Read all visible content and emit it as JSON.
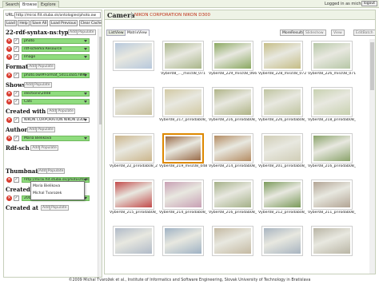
{
  "top_tabs": [
    "Search",
    "Browse",
    "Explore"
  ],
  "logged_in": "Logged in as michal",
  "logout_label": "logout",
  "url_label": "URL:",
  "url_value": "http://mirai.fiit.stuba.sk/ontologies/photo.ow",
  "toolbar": [
    "Load",
    "Help",
    "Save All",
    "Load Previous",
    "Clear Cache"
  ],
  "sections": [
    {
      "title": "22-rdf-syntax-ns:type",
      "add": "Add",
      "populate": "Populate",
      "entries": [
        {
          "value": "photo",
          "style": "green"
        },
        {
          "value": "rdf-schema:Resource",
          "style": "green"
        },
        {
          "value": "Image",
          "style": "green"
        }
      ]
    },
    {
      "title": "Format",
      "add": "Add",
      "populate": "Populate",
      "entries": [
        {
          "value": "photo.owl#Format_5d113aa5789b",
          "style": "green"
        }
      ]
    },
    {
      "title": "Shows",
      "add": "Add",
      "populate": "Populate",
      "entries": [
        {
          "value": "elections\\2008",
          "style": "green"
        },
        {
          "value": "Cats",
          "style": "green"
        }
      ]
    },
    {
      "title": "Created with",
      "add": "Add",
      "populate": "Populate",
      "entries": [
        {
          "value": "NIKON CORPORATION NIKON D300",
          "style": "white"
        }
      ]
    },
    {
      "title": "Author",
      "add": "Add",
      "populate": "Populate",
      "entries": [
        {
          "value": "Maria Bielikova",
          "style": "green"
        }
      ]
    },
    {
      "title": "Rdf-sch",
      "add": "Add",
      "populate": "Populate",
      "entries": []
    },
    {
      "title": "Thumbnail",
      "add": "Add",
      "populate": "Populate",
      "entries": [
        {
          "value": "http://mirai.fiit.stuba.sk/photos/tb/tb_Vyber08_",
          "style": "green"
        }
      ]
    },
    {
      "title": "Created on",
      "add": "Add",
      "populate": "Populate",
      "entries": [
        {
          "value": "2008:08:24",
          "style": "green"
        }
      ]
    },
    {
      "title": "Created at",
      "add": "Add",
      "populate": "Populate",
      "entries": []
    }
  ],
  "author_dropdown": [
    "Maria Bielikova",
    "Michal Tvarozek"
  ],
  "right": {
    "title": "Camera",
    "value": "NIKON CORPORATION NIKON D300",
    "tabs": [
      "ListView",
      "MatrixView"
    ],
    "buttons": [
      "MoreResults",
      "Slideshow",
      "View",
      "EditBatch"
    ]
  },
  "photos": [
    {
      "caption": "",
      "color": "#b7c8dc"
    },
    {
      "caption": "Vyber08_..._misc08_071",
      "color": "#a9b68a"
    },
    {
      "caption": "Vyber08_229_misc08_066",
      "color": "#8aa860"
    },
    {
      "caption": "Vyber08_228_misc08_072",
      "color": "#c5bd86"
    },
    {
      "caption": "Vyber08_226_misc08_071",
      "color": "#b6c7a6"
    },
    {
      "caption": "",
      "color": "#c9c19e"
    },
    {
      "caption": "Vyber08_217_prirodab08_2",
      "color": "#d2c9a3"
    },
    {
      "caption": "Vyber08_216_prirodab08_2",
      "color": "#b0b487"
    },
    {
      "caption": "Vyber08_226_prirodab08_2",
      "color": "#bfc4a0"
    },
    {
      "caption": "Vyber08_218_prirodab08_2",
      "color": "#c8d1b0"
    },
    {
      "caption": "Vyber08_22_prirodab08_2",
      "color": "#cbb58b"
    },
    {
      "caption": "Vyber08_219_misc08_048",
      "color": "#9a6b48"
    },
    {
      "caption": "Vyber08_214_prirodab08_1",
      "color": "#b48c62"
    },
    {
      "caption": "Vyber08_201_prirodab08_1",
      "color": "#d0cdb6"
    },
    {
      "caption": "Vyber08_216_prirodab08_1",
      "color": "#8aa36a"
    },
    {
      "caption": "Vyber08_215_prirodab08_1",
      "color": "#c24a4a"
    },
    {
      "caption": "Vyber08_214_prirodab08_1",
      "color": "#c8a0b4"
    },
    {
      "caption": "Vyber08_216_prirodab08_1",
      "color": "#a4b088"
    },
    {
      "caption": "Vyber08_212_prirodab08_1",
      "color": "#7a9a5a"
    },
    {
      "caption": "Vyber08_211_prirodab08_1",
      "color": "#b2a494"
    },
    {
      "caption": "",
      "color": "#b0bac8"
    },
    {
      "caption": "",
      "color": "#9fb2c4"
    },
    {
      "caption": "",
      "color": "#c4b9a2"
    },
    {
      "caption": "",
      "color": "#a8b4c0"
    },
    {
      "caption": "",
      "color": "#b9b5a5"
    }
  ],
  "selected_index": 11,
  "footer": "©2009 Michal Tvarožek et al., Institute of Informatics and Software Engineering, Slovak University of Technology in Bratislava"
}
